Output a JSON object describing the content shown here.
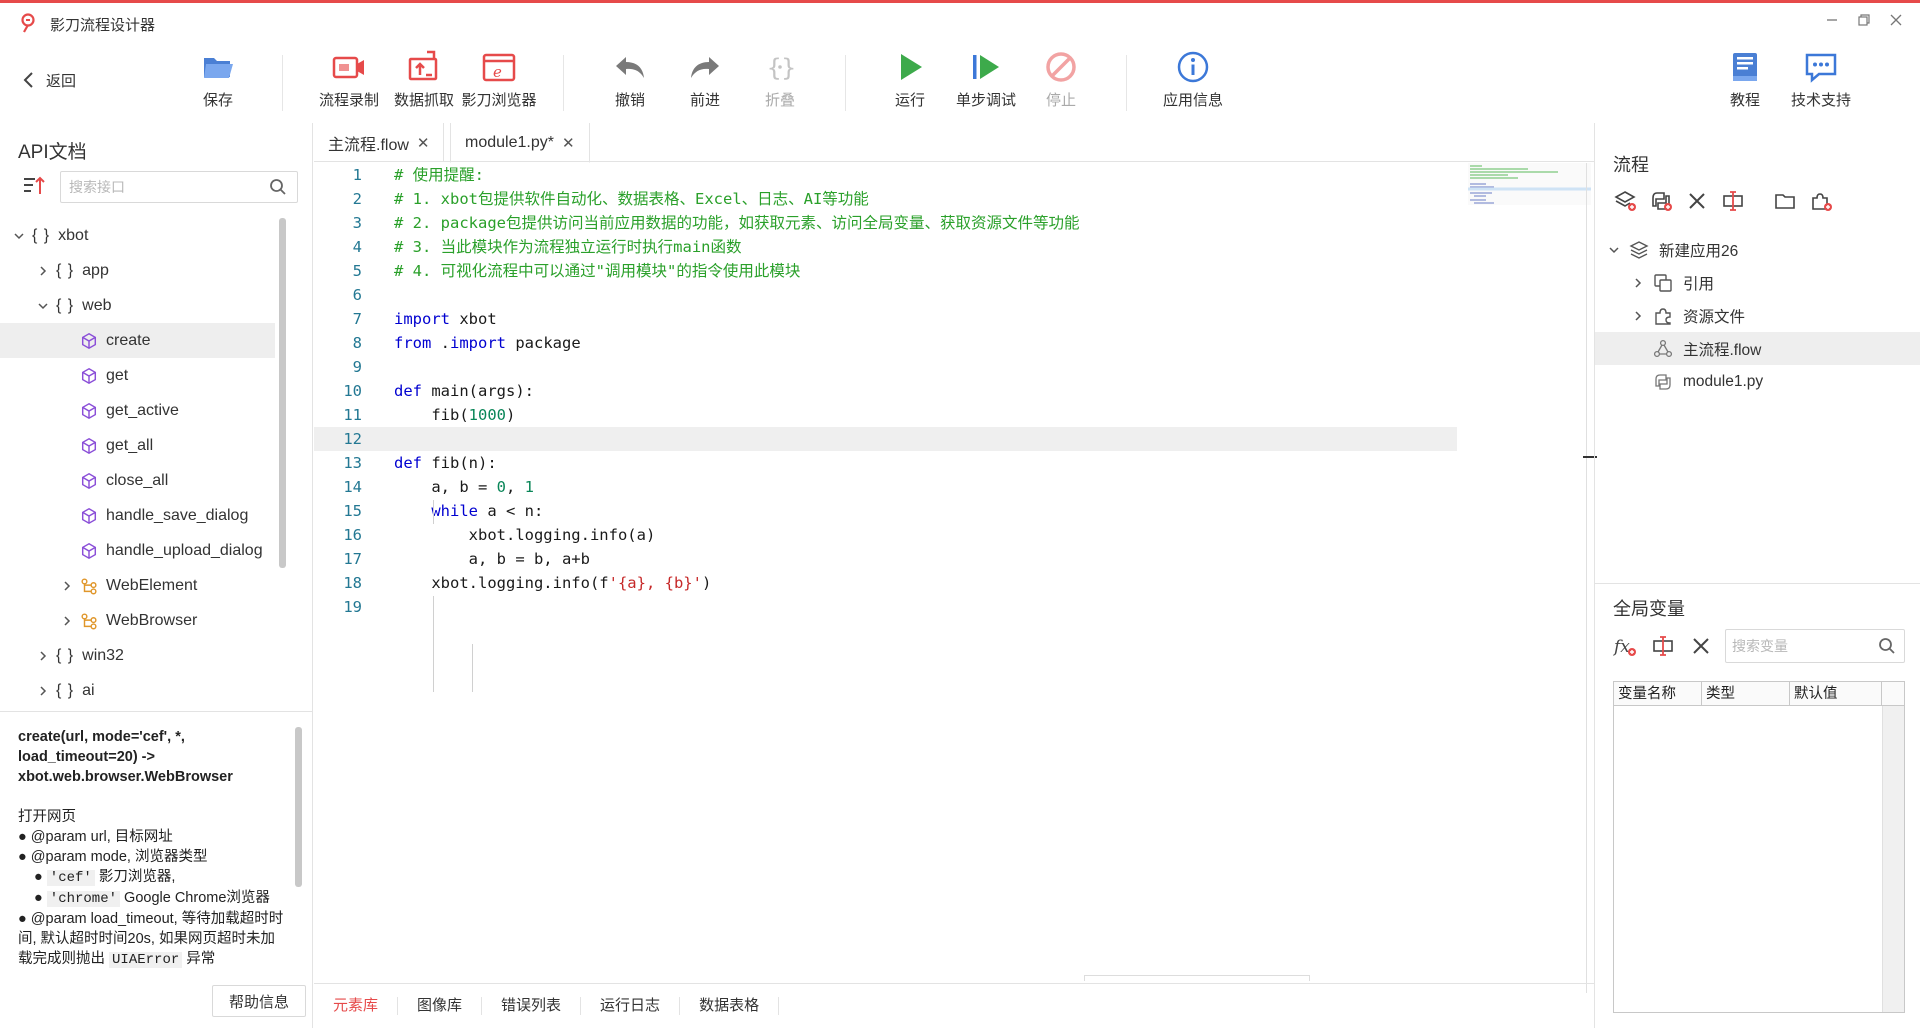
{
  "window": {
    "title": "影刀流程设计器"
  },
  "toolbar": {
    "back_label": "返回",
    "save_label": "保存",
    "record_label": "流程录制",
    "scrape_label": "数据抓取",
    "browser_label": "影刀浏览器",
    "undo_label": "撤销",
    "redo_label": "前进",
    "fold_label": "折叠",
    "run_label": "运行",
    "step_label": "单步调试",
    "stop_label": "停止",
    "info_label": "应用信息",
    "tutorial_label": "教程",
    "support_label": "技术支持"
  },
  "api_panel": {
    "title": "API文档",
    "search_placeholder": "搜索接口",
    "tree": [
      {
        "label": "xbot",
        "kind": "module",
        "level": 0,
        "expanded": true
      },
      {
        "label": "app",
        "kind": "module",
        "level": 1,
        "expanded": false
      },
      {
        "label": "web",
        "kind": "module",
        "level": 1,
        "expanded": true
      },
      {
        "label": "create",
        "kind": "function",
        "level": 2,
        "selected": true
      },
      {
        "label": "get",
        "kind": "function",
        "level": 2
      },
      {
        "label": "get_active",
        "kind": "function",
        "level": 2
      },
      {
        "label": "get_all",
        "kind": "function",
        "level": 2
      },
      {
        "label": "close_all",
        "kind": "function",
        "level": 2
      },
      {
        "label": "handle_save_dialog",
        "kind": "function",
        "level": 2
      },
      {
        "label": "handle_upload_dialog",
        "kind": "function",
        "level": 2
      },
      {
        "label": "WebElement",
        "kind": "class",
        "level": 2,
        "expanded": false
      },
      {
        "label": "WebBrowser",
        "kind": "class",
        "level": 2,
        "expanded": false
      },
      {
        "label": "win32",
        "kind": "module",
        "level": 1,
        "expanded": false
      },
      {
        "label": "ai",
        "kind": "module",
        "level": 1,
        "expanded": false
      }
    ],
    "doc": {
      "signature": "create(url, mode='cef', *, load_timeout=20) -> xbot.web.browser.WebBrowser",
      "description": "打开网页",
      "param_url": "● @param url, 目标网址",
      "param_mode": "● @param mode, 浏览器类型",
      "mode_cef_bullet": "● ",
      "mode_cef_code": "'cef'",
      "mode_cef_text": " 影刀浏览器,",
      "mode_chrome_bullet": "● ",
      "mode_chrome_code": "'chrome'",
      "mode_chrome_text": " Google Chrome浏览器",
      "param_timeout": "● @param load_timeout, 等待加载超时时间, 默认超时时间20s, 如果网页超时未加载完成则抛出",
      "error_code": "UIAError",
      "error_suffix": " 异常"
    },
    "help_button": "帮助信息"
  },
  "editor": {
    "tabs": [
      {
        "label": "主流程.flow"
      },
      {
        "label": "module1.py*"
      }
    ],
    "lines": [
      {
        "n": "1",
        "tokens": [
          [
            "cm",
            "# 使用提醒:"
          ]
        ]
      },
      {
        "n": "2",
        "tokens": [
          [
            "cm",
            "# 1. xbot包提供软件自动化、数据表格、Excel、日志、AI等功能"
          ]
        ]
      },
      {
        "n": "3",
        "tokens": [
          [
            "cm",
            "# 2. package包提供访问当前应用数据的功能，如获取元素、访问全局变量、获取资源文件等功能"
          ]
        ]
      },
      {
        "n": "4",
        "tokens": [
          [
            "cm",
            "# 3. 当此模块作为流程独立运行时执行main函数"
          ]
        ]
      },
      {
        "n": "5",
        "tokens": [
          [
            "cm",
            "# 4. 可视化流程中可以通过\"调用模块\"的指令使用此模块"
          ]
        ]
      },
      {
        "n": "6",
        "tokens": []
      },
      {
        "n": "7",
        "tokens": [
          [
            "kw",
            "import"
          ],
          [
            "tx",
            " xbot"
          ]
        ]
      },
      {
        "n": "8",
        "tokens": [
          [
            "kw",
            "from"
          ],
          [
            "tx",
            " ."
          ],
          [
            "kw",
            "import"
          ],
          [
            "tx",
            " package"
          ]
        ]
      },
      {
        "n": "9",
        "tokens": []
      },
      {
        "n": "10",
        "tokens": [
          [
            "kw",
            "def"
          ],
          [
            "tx",
            " main(args):"
          ]
        ]
      },
      {
        "n": "11",
        "tokens": [
          [
            "tx",
            "    fib("
          ],
          [
            "num",
            "1000"
          ],
          [
            "tx",
            ")"
          ]
        ]
      },
      {
        "n": "12",
        "tokens": [],
        "current": true
      },
      {
        "n": "13",
        "tokens": [
          [
            "kw",
            "def"
          ],
          [
            "tx",
            " fib(n):"
          ]
        ]
      },
      {
        "n": "14",
        "tokens": [
          [
            "tx",
            "    a, b = "
          ],
          [
            "num",
            "0"
          ],
          [
            "tx",
            ", "
          ],
          [
            "num",
            "1"
          ]
        ]
      },
      {
        "n": "15",
        "tokens": [
          [
            "tx",
            "    "
          ],
          [
            "kw",
            "while"
          ],
          [
            "tx",
            " a < n:"
          ]
        ]
      },
      {
        "n": "16",
        "tokens": [
          [
            "tx",
            "        xbot.logging.info(a)"
          ]
        ]
      },
      {
        "n": "17",
        "tokens": [
          [
            "tx",
            "        a, b = b, a+b"
          ]
        ]
      },
      {
        "n": "18",
        "tokens": [
          [
            "tx",
            "    xbot.logging.info(f"
          ],
          [
            "str",
            "'{a}, {b}'"
          ],
          [
            "tx",
            ")"
          ]
        ]
      },
      {
        "n": "19",
        "tokens": []
      }
    ],
    "bottom_tabs": [
      "元素库",
      "图像库",
      "错误列表",
      "运行日志",
      "数据表格"
    ]
  },
  "flow_panel": {
    "title": "流程",
    "tree": [
      {
        "label": "新建应用26",
        "icon": "layers-icon",
        "level": 0,
        "expanded": true
      },
      {
        "label": "引用",
        "icon": "copy-icon",
        "level": 1,
        "expanded": false
      },
      {
        "label": "资源文件",
        "icon": "puzzle-icon",
        "level": 1,
        "expanded": false
      },
      {
        "label": "主流程.flow",
        "icon": "flow-icon",
        "level": 1,
        "selected": true,
        "leaf": true
      },
      {
        "label": "module1.py",
        "icon": "python-icon",
        "level": 1,
        "leaf": true
      }
    ]
  },
  "variables_panel": {
    "title": "全局变量",
    "search_placeholder": "搜索变量",
    "columns": [
      "变量名称",
      "类型",
      "默认值"
    ]
  },
  "colors": {
    "accent": "#e64a4a",
    "comment": "#2aa02a",
    "keyword": "#0000d0",
    "number": "#098658",
    "string": "#c62828",
    "line_number": "#237893"
  }
}
